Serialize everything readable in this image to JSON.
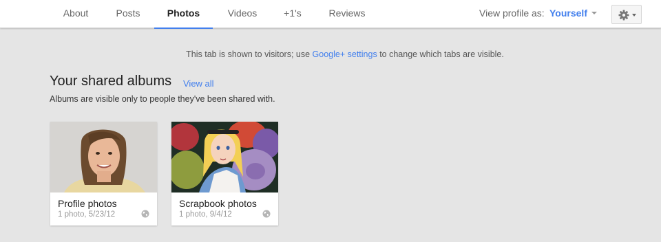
{
  "tabs": [
    {
      "label": "About",
      "active": false
    },
    {
      "label": "Posts",
      "active": false
    },
    {
      "label": "Photos",
      "active": true
    },
    {
      "label": "Videos",
      "active": false
    },
    {
      "label": "+1's",
      "active": false
    },
    {
      "label": "Reviews",
      "active": false
    }
  ],
  "view_profile": {
    "label": "View profile as:",
    "value": "Yourself"
  },
  "notice": {
    "prefix": "This tab is shown to visitors; use ",
    "link": "Google+ settings",
    "suffix": " to change which tabs are visible."
  },
  "albums_section": {
    "title": "Your shared albums",
    "view_all": "View all",
    "subtitle": "Albums are visible only to people they've been shared with."
  },
  "albums": [
    {
      "name": "Profile photos",
      "meta": "1 photo, 5/23/12",
      "icon": "globe-icon"
    },
    {
      "name": "Scrapbook photos",
      "meta": "1 photo, 9/4/12",
      "icon": "globe-icon"
    }
  ],
  "colors": {
    "accent": "#427fed",
    "background": "#e5e5e5"
  },
  "icons": {
    "settings": "gear-icon"
  }
}
